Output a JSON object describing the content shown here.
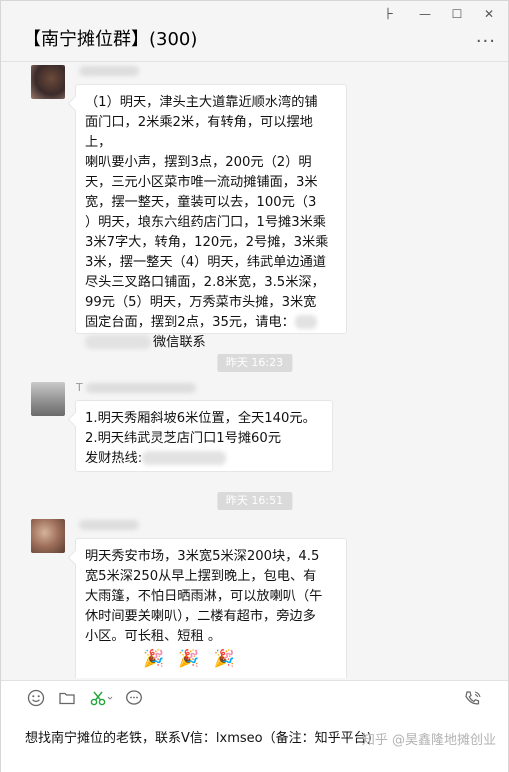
{
  "window": {
    "title": "【南宁摊位群】(300)",
    "controls": {
      "pin": "⺊",
      "minimize": "—",
      "maximize": "☐",
      "close": "✕"
    },
    "more_label": "···"
  },
  "messages": [
    {
      "sender_prefix": "",
      "lines": [
        "（1）明天，津头主大道靠近顺水湾的铺",
        "面门口，2米乘2米，有转角，可以摆地上，",
        "喇叭要小声，摆到3点，200元（2）明",
        "天，三元小区菜市唯一流动摊铺面，3米",
        "宽，摆一整天，童装可以去，100元（3",
        "）明天，埌东六组药店门口，1号摊3米乘",
        "3米7字大，转角，120元，2号摊，3米乘",
        "3米，摆一整天（4）明天，纬武单边通道",
        "尽头三叉路口铺面，2.8米宽，3.5米深，",
        "99元（5）明天，万秀菜市头摊，3米宽",
        "固定台面，摆到2点，35元，请电："
      ],
      "tail": "微信联系"
    },
    {
      "sender_prefix": "T",
      "lines": [
        "1.明天秀厢斜坡6米位置，全天140元。",
        "2.明天纬武灵芝店门口1号摊60元"
      ],
      "tail_prefix": "发财热线:"
    },
    {
      "sender_prefix": "",
      "lines": [
        "明天秀安市场，3米宽5米深200块，4.5",
        "宽5米深250从早上摆到晚上，包电、有",
        "大雨篷，不怕日晒雨淋，可以放喇叭（午",
        "休时间要关喇叭），二楼有超市，旁边多",
        "小区。可长租、短租 。"
      ],
      "emojis": [
        "🎉",
        "🎉",
        "🎉"
      ]
    }
  ],
  "timestamps": [
    "昨天 16:23",
    "昨天 16:51"
  ],
  "composer": {
    "text": "想找南宁摊位的老铁，联系V信：lxmseo（备注：知乎平台)",
    "watermark": "知乎 @昊鑫隆地摊创业",
    "tools": [
      "emoji-icon",
      "folder-icon",
      "scissors-icon",
      "chat-bubble-icon",
      "phone-icon"
    ]
  }
}
